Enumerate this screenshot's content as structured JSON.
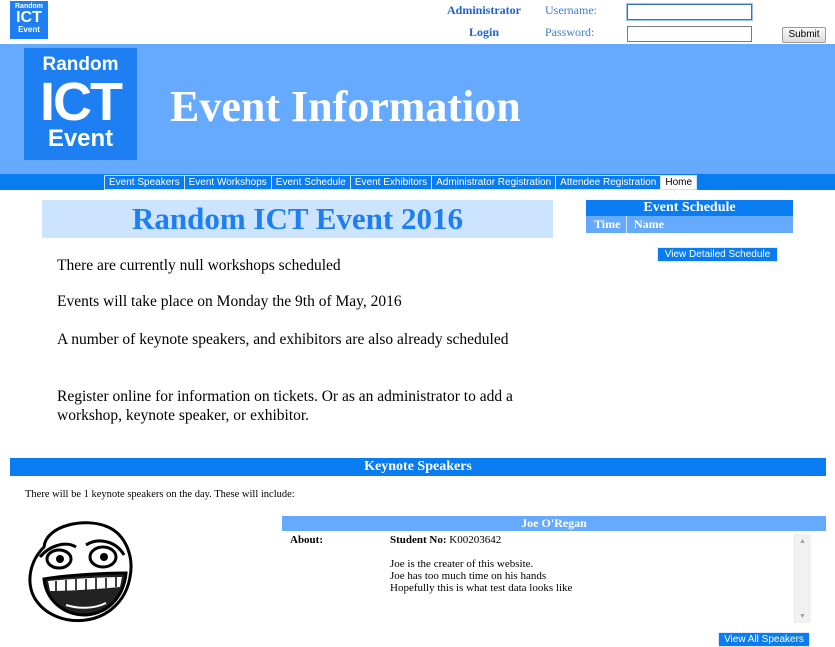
{
  "logo": {
    "line1": "Random",
    "line2": "ICT",
    "line3": "Event"
  },
  "login": {
    "admin_link": "Administrator",
    "login_link": "Login",
    "username_label": "Username:",
    "password_label": "Password:",
    "username_value": "",
    "password_value": "",
    "submit_label": "Submit"
  },
  "banner": {
    "title": "Event Information"
  },
  "nav": {
    "items": [
      "Event Speakers",
      "Event Workshops",
      "Event Schedule",
      "Event Exhibitors",
      "Administrator Registration",
      "Attendee Registration",
      "Home"
    ],
    "active": "Home"
  },
  "intro": {
    "title": "Random ICT Event 2016",
    "p1": "There are currently null workshops scheduled",
    "p2": "Events will take place on Monday the 9th of May, 2016",
    "p3": "A number of keynote speakers, and exhibitors are also already scheduled",
    "p4": "Register online for information on tickets. Or as an administrator to add a workshop, keynote speaker, or exhibitor."
  },
  "schedule": {
    "title": "Event Schedule",
    "col_time": "Time",
    "col_name": "Name",
    "button": "View Detailed Schedule"
  },
  "keynote": {
    "title": "Keynote Speakers",
    "summary": "There will be 1 keynote speakers on the day. These will include:",
    "speaker": {
      "name": "Joe O'Regan",
      "about_label": "About:",
      "student_label": "Student No:",
      "student_no": "K00203642",
      "desc1": "Joe is the creater of this website.",
      "desc2": "Joe has too much time on his hands",
      "desc3": "Hopefully this is what test data looks like"
    },
    "view_all": "View All Speakers"
  },
  "colors": {
    "primary": "#0a7cf2",
    "banner": "#66aaff",
    "intro_bg": "#cce4ff"
  },
  "icons": {
    "scroll_up": "triangle-up",
    "scroll_down": "triangle-down",
    "speaker_image": "troll-face"
  }
}
